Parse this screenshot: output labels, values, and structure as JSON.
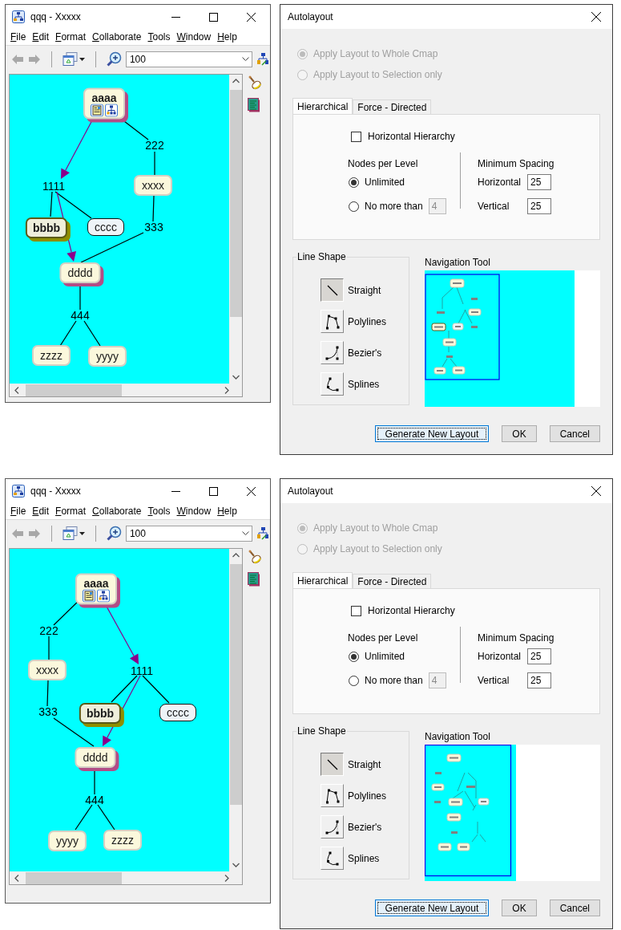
{
  "panels": [
    {
      "cmap_window": {
        "title": "qqq - Xxxxx",
        "menu": [
          "File",
          "Edit",
          "Format",
          "Collaborate",
          "Tools",
          "Window",
          "Help"
        ],
        "zoom_field": {
          "value": "100"
        },
        "map": {
          "nodes": [
            {
              "label": "aaaa",
              "kind": "root"
            },
            {
              "label": "222",
              "kind": "phrase"
            },
            {
              "label": "1111",
              "kind": "phrase"
            },
            {
              "label": "xxxx",
              "kind": "concept"
            },
            {
              "label": "bbbb",
              "kind": "emphasized"
            },
            {
              "label": "cccc",
              "kind": "outlined"
            },
            {
              "label": "333",
              "kind": "phrase"
            },
            {
              "label": "dddd",
              "kind": "shadowed"
            },
            {
              "label": "444",
              "kind": "phrase"
            },
            {
              "label": "zzzz",
              "kind": "concept"
            },
            {
              "label": "yyyy",
              "kind": "concept"
            }
          ]
        }
      },
      "autolayout_dialog": {
        "title": "Autolayout",
        "scope_options": [
          {
            "label": "Apply Layout to Whole Cmap",
            "selected": true,
            "disabled": true
          },
          {
            "label": "Apply Layout to Selection only",
            "selected": false,
            "disabled": true
          }
        ],
        "tabs": [
          {
            "label": "Hierarchical",
            "selected": true
          },
          {
            "label": "Force - Directed",
            "selected": false
          }
        ],
        "horizontal_hierarchy": {
          "label": "Horizontal Hierarchy",
          "checked": false
        },
        "nodes_per_level": {
          "title": "Nodes per Level",
          "options": [
            {
              "label": "Unlimited",
              "selected": true
            },
            {
              "label": "No more than",
              "selected": false
            }
          ],
          "limit": {
            "value": "4",
            "disabled": true
          }
        },
        "minimum_spacing": {
          "title": "Minimum Spacing",
          "fields": [
            {
              "label": "Horizontal",
              "value": "25"
            },
            {
              "label": "Vertical",
              "value": "25"
            }
          ]
        },
        "line_shape": {
          "title": "Line Shape",
          "options": [
            {
              "label": "Straight",
              "kind": "straight",
              "selected": true
            },
            {
              "label": "Polylines",
              "kind": "polylines",
              "selected": false
            },
            {
              "label": "Bezier's",
              "kind": "bezier",
              "selected": false
            },
            {
              "label": "Splines",
              "kind": "splines",
              "selected": false
            }
          ]
        },
        "navigation_tool": {
          "title": "Navigation Tool"
        },
        "buttons": [
          {
            "label": "Generate New Layout",
            "focused": true
          },
          {
            "label": "OK",
            "focused": false
          },
          {
            "label": "Cancel",
            "focused": false
          }
        ]
      }
    },
    {
      "cmap_window": {
        "title": "qqq - Xxxxx",
        "menu": [
          "File",
          "Edit",
          "Format",
          "Collaborate",
          "Tools",
          "Window",
          "Help"
        ],
        "zoom_field": {
          "value": "100"
        },
        "map": {
          "nodes": [
            {
              "label": "aaaa",
              "kind": "root"
            },
            {
              "label": "222",
              "kind": "phrase"
            },
            {
              "label": "xxxx",
              "kind": "concept"
            },
            {
              "label": "1111",
              "kind": "phrase"
            },
            {
              "label": "333",
              "kind": "phrase"
            },
            {
              "label": "bbbb",
              "kind": "emphasized"
            },
            {
              "label": "cccc",
              "kind": "outlined"
            },
            {
              "label": "dddd",
              "kind": "shadowed"
            },
            {
              "label": "444",
              "kind": "phrase"
            },
            {
              "label": "yyyy",
              "kind": "concept"
            },
            {
              "label": "zzzz",
              "kind": "concept"
            }
          ]
        }
      },
      "autolayout_dialog": {
        "title": "Autolayout",
        "scope_options": [
          {
            "label": "Apply Layout to Whole Cmap",
            "selected": true,
            "disabled": true
          },
          {
            "label": "Apply Layout to Selection only",
            "selected": false,
            "disabled": true
          }
        ],
        "tabs": [
          {
            "label": "Hierarchical",
            "selected": true
          },
          {
            "label": "Force - Directed",
            "selected": false
          }
        ],
        "horizontal_hierarchy": {
          "label": "Horizontal Hierarchy",
          "checked": false
        },
        "nodes_per_level": {
          "title": "Nodes per Level",
          "options": [
            {
              "label": "Unlimited",
              "selected": true
            },
            {
              "label": "No more than",
              "selected": false
            }
          ],
          "limit": {
            "value": "4",
            "disabled": true
          }
        },
        "minimum_spacing": {
          "title": "Minimum Spacing",
          "fields": [
            {
              "label": "Horizontal",
              "value": "25"
            },
            {
              "label": "Vertical",
              "value": "25"
            }
          ]
        },
        "line_shape": {
          "title": "Line Shape",
          "options": [
            {
              "label": "Straight",
              "kind": "straight",
              "selected": true
            },
            {
              "label": "Polylines",
              "kind": "polylines",
              "selected": false
            },
            {
              "label": "Bezier's",
              "kind": "bezier",
              "selected": false
            },
            {
              "label": "Splines",
              "kind": "splines",
              "selected": false
            }
          ]
        },
        "navigation_tool": {
          "title": "Navigation Tool"
        },
        "buttons": [
          {
            "label": "Generate New Layout",
            "focused": true
          },
          {
            "label": "OK",
            "focused": false
          },
          {
            "label": "Cancel",
            "focused": false
          }
        ]
      }
    }
  ]
}
